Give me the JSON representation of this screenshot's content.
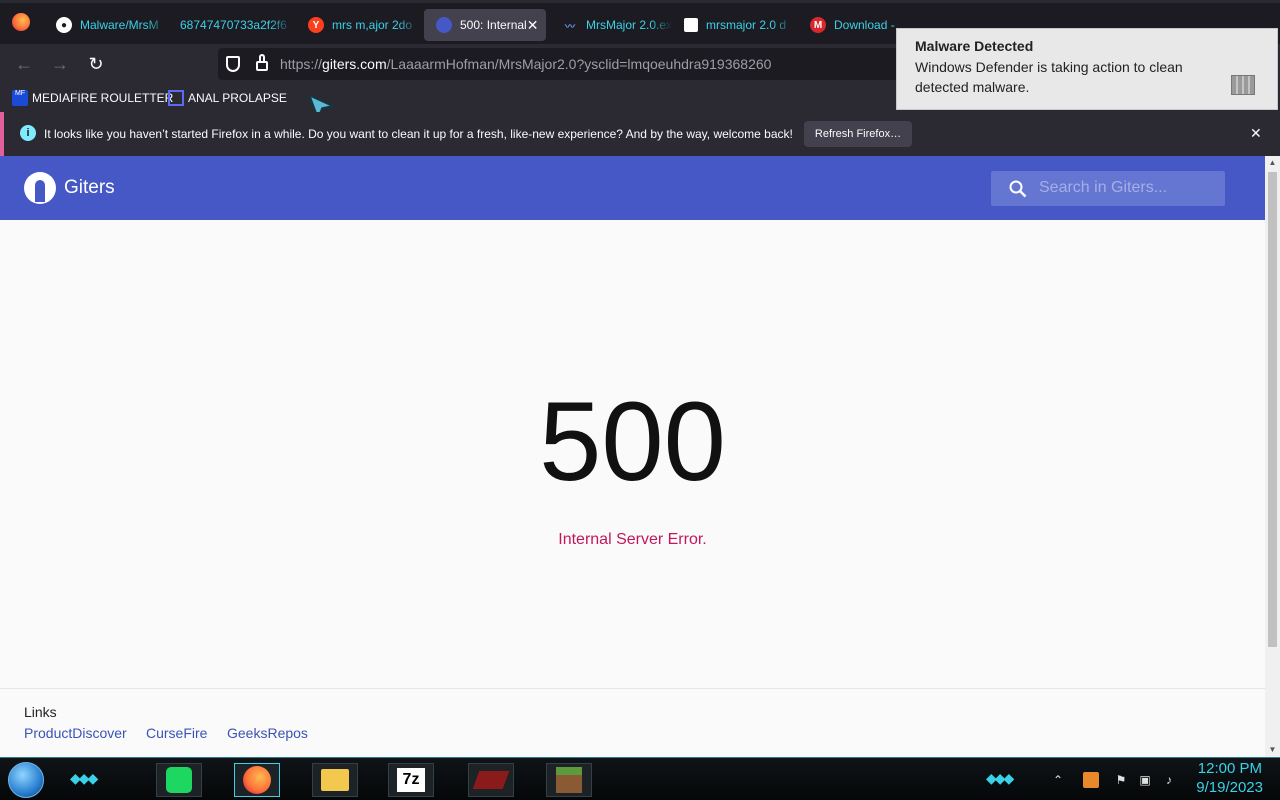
{
  "browser": {
    "tabs": [
      {
        "label": "Malware/MrsM",
        "icon": "github-icon",
        "active": false
      },
      {
        "label": "68747470733a2f2f6",
        "icon": "none",
        "active": false
      },
      {
        "label": "mrs m,ajor 2do",
        "icon": "yandex-icon",
        "active": false
      },
      {
        "label": "500: Internal",
        "icon": "giters-icon",
        "active": true
      },
      {
        "label": "MrsMajor 2.0.ex",
        "icon": "chart-icon",
        "active": false
      },
      {
        "label": "mrsmajor 2.0 d",
        "icon": "file-icon",
        "active": false
      },
      {
        "label": "Download -",
        "icon": "mega-icon",
        "active": false
      },
      {
        "label": "M",
        "icon": "mega-icon",
        "active": false
      }
    ],
    "url": {
      "prefix": "https://",
      "host": "giters.com",
      "path": "/LaaaarmHofman/MrsMajor2.0?ysclid=lmqoeuhdra919368260"
    },
    "bookmarks": [
      {
        "label": "MEDIAFIRE ROULETTER",
        "icon": "mediafire-icon"
      },
      {
        "label": "ANAL PROLAPSE",
        "icon": "bookmark-icon"
      }
    ],
    "notification": {
      "text": "It looks like you haven’t started Firefox in a while. Do you want to clean it up for a fresh, like-new experience? And by the way, welcome back!",
      "button": "Refresh Firefox…"
    }
  },
  "site": {
    "name": "Giters",
    "search_placeholder": "Search in Giters...",
    "error_code": "500",
    "error_message": "Internal Server Error.",
    "footer": {
      "heading": "Links",
      "links": [
        "ProductDiscover",
        "CurseFire",
        "GeeksRepos"
      ]
    }
  },
  "toast": {
    "title": "Malware Detected",
    "body": "Windows Defender is taking action to clean detected malware."
  },
  "taskbar": {
    "time": "12:00 PM",
    "date": "9/19/2023",
    "apps": [
      "spotify-icon",
      "firefox-icon",
      "file-explorer-icon",
      "7zip-icon",
      "game-icon",
      "minecraft-icon"
    ]
  },
  "colors": {
    "site_header": "#4558c6",
    "error_text": "#c2185b",
    "tab_text": "#3ad1e8"
  }
}
